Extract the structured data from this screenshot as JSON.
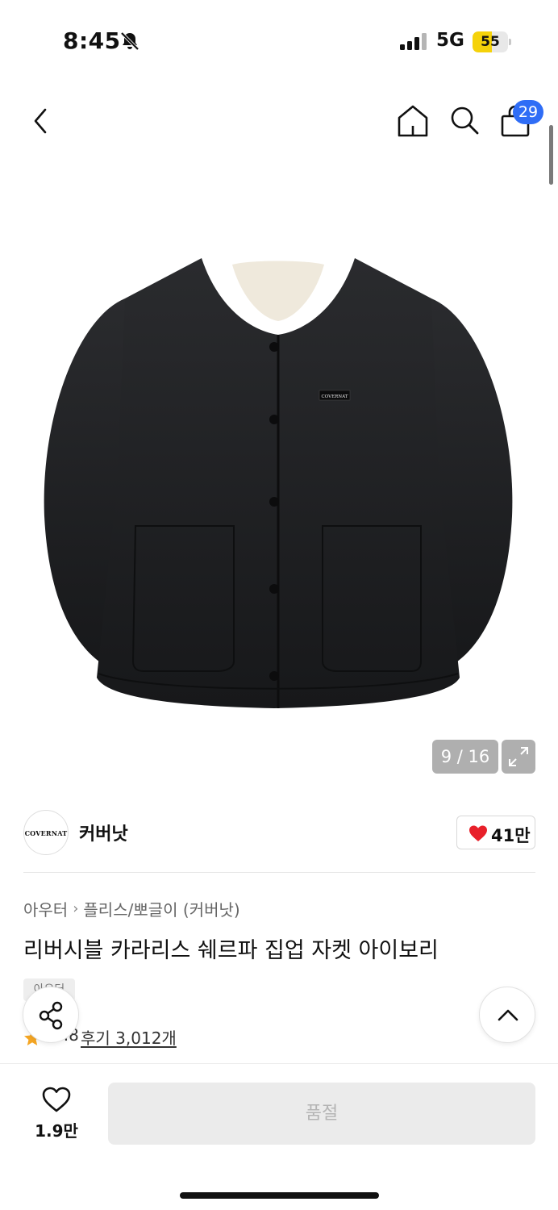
{
  "status_bar": {
    "time": "8:45",
    "network": "5G",
    "battery_percent": "55",
    "battery_level": 0.55,
    "icons": [
      "bell-slash-icon",
      "signal-icon"
    ]
  },
  "header": {
    "icons": [
      "back-icon",
      "home-icon",
      "search-icon",
      "shopping-bag-icon"
    ],
    "cart_count": "29"
  },
  "gallery": {
    "counter": "9 / 16",
    "product_logo_text": "COVERNAT",
    "expand_icon": "expand-icon"
  },
  "brand": {
    "logo_text": "COVERNAT",
    "name": "커버낫",
    "like_count": "41만",
    "like_color": "#e8202a"
  },
  "product": {
    "breadcrumb": [
      "아우터",
      "플리스/뽀글이 (커버낫)"
    ],
    "title": "리버시블 카라리스 쉐르파 집업 자켓 아이보리",
    "tag": "아우터",
    "rating": "4.8",
    "review_label": "후기 3,012개"
  },
  "actions": {
    "wish_count": "1.9만",
    "soldout_label": "품절",
    "icons": [
      "share-icon",
      "chevron-up-icon",
      "heart-outline-icon",
      "star-icon"
    ]
  },
  "colors": {
    "accent_badge": "#2f6df6",
    "star": "#f5a623",
    "soldout_bg": "#ebebeb"
  }
}
